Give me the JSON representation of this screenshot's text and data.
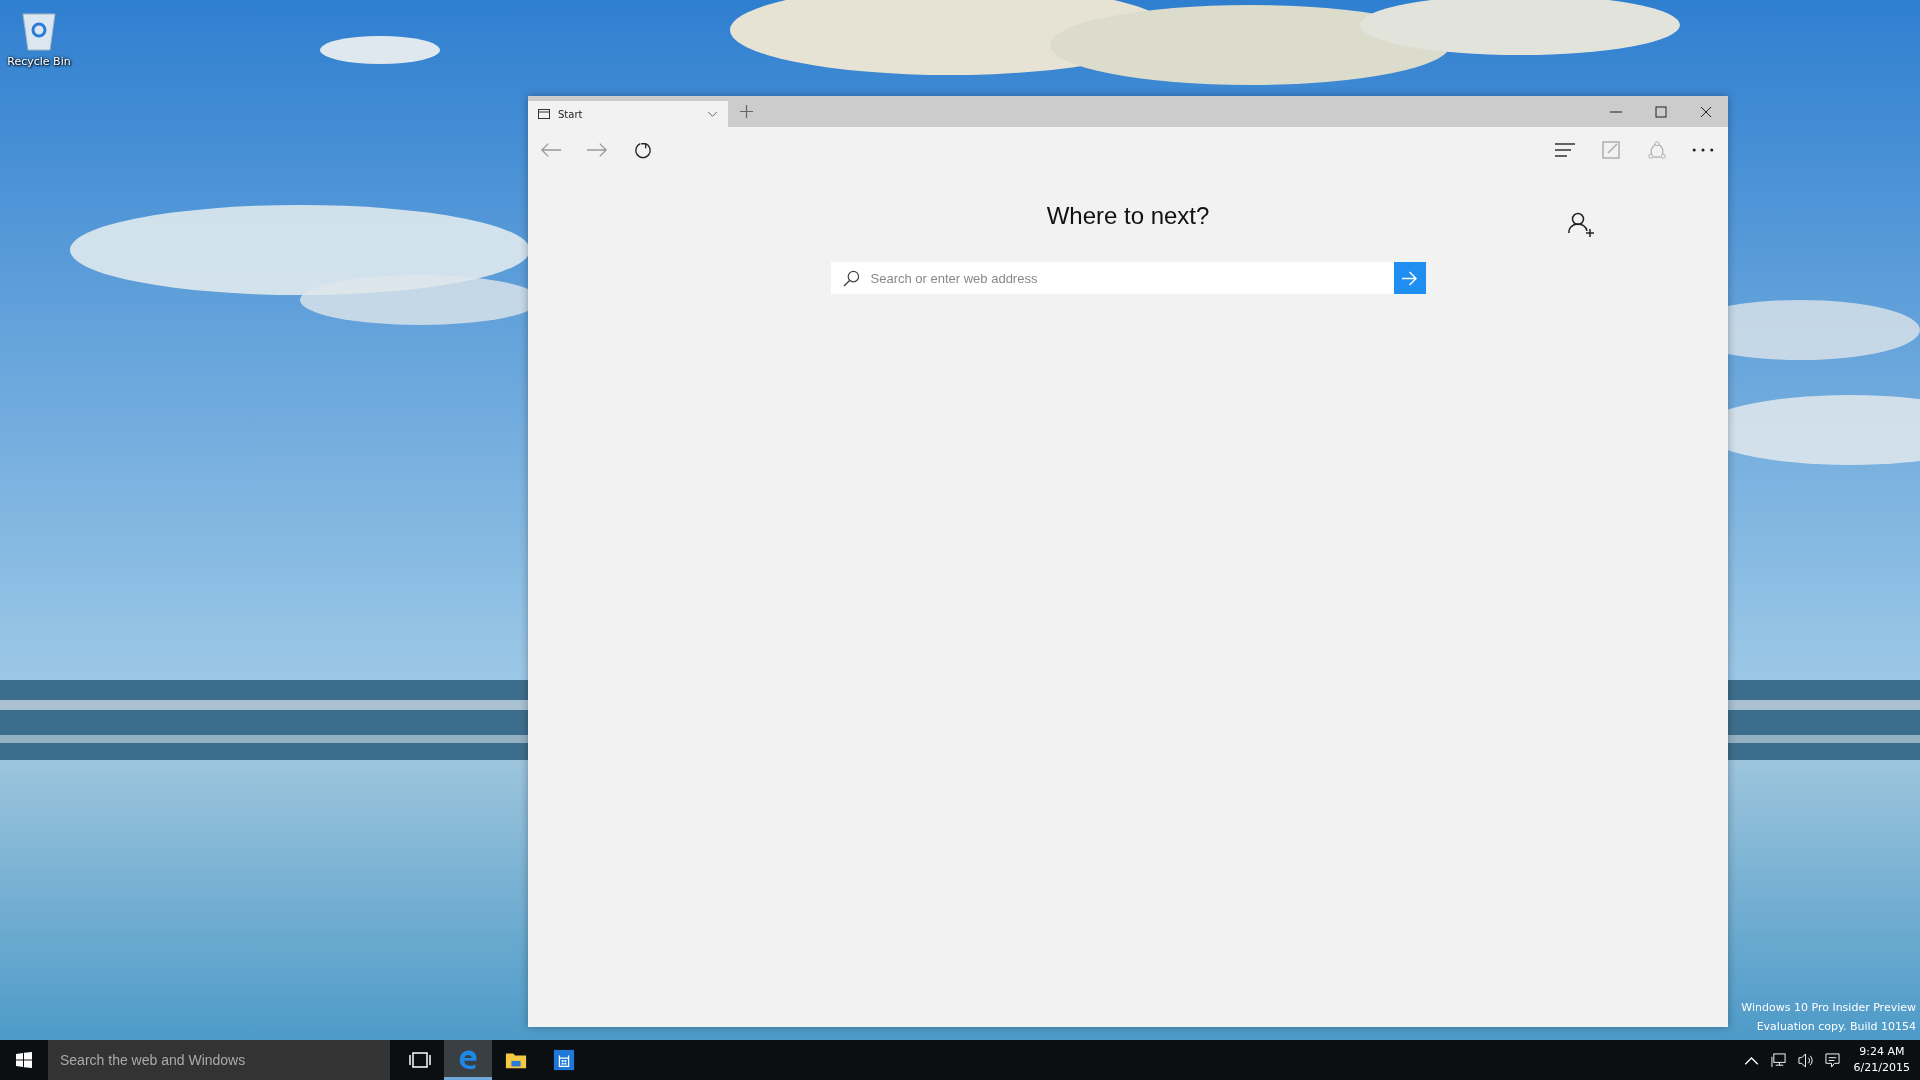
{
  "desktop": {
    "icons": [
      {
        "label": "Recycle Bin"
      }
    ],
    "watermark": [
      "Windows 10 Pro Insider Preview",
      "Evaluation copy. Build 10154"
    ]
  },
  "browser": {
    "tabs": [
      {
        "title": "Start",
        "selected": true
      }
    ],
    "heading": "Where to next?",
    "search": {
      "placeholder": "Search or enter web address"
    }
  },
  "taskbar": {
    "search": {
      "placeholder": "Search the web and Windows"
    },
    "apps": [
      {
        "kind": "task-view",
        "selected": false
      },
      {
        "kind": "edge",
        "selected": true
      },
      {
        "kind": "explorer",
        "selected": false
      },
      {
        "kind": "store",
        "selected": false
      }
    ],
    "clock": {
      "time": "9:24 AM",
      "date": "6/21/2015"
    }
  }
}
